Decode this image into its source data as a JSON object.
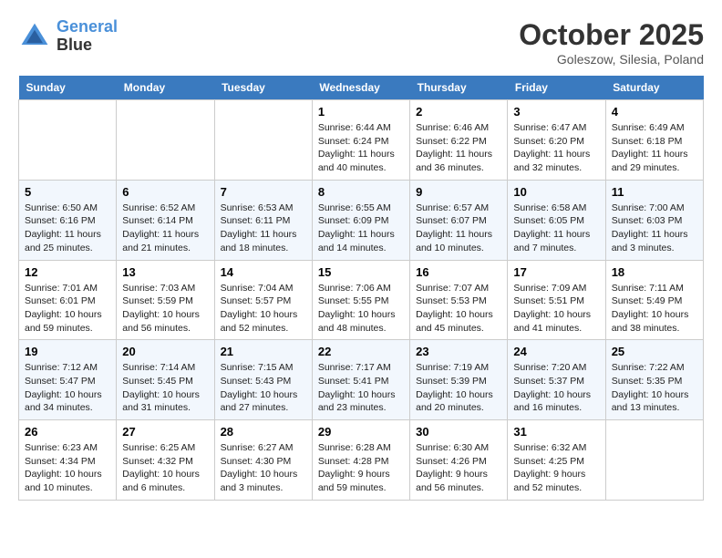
{
  "header": {
    "logo_line1": "General",
    "logo_line2": "Blue",
    "month": "October 2025",
    "location": "Goleszow, Silesia, Poland"
  },
  "weekdays": [
    "Sunday",
    "Monday",
    "Tuesday",
    "Wednesday",
    "Thursday",
    "Friday",
    "Saturday"
  ],
  "weeks": [
    [
      {
        "day": "",
        "info": ""
      },
      {
        "day": "",
        "info": ""
      },
      {
        "day": "",
        "info": ""
      },
      {
        "day": "1",
        "info": "Sunrise: 6:44 AM\nSunset: 6:24 PM\nDaylight: 11 hours\nand 40 minutes."
      },
      {
        "day": "2",
        "info": "Sunrise: 6:46 AM\nSunset: 6:22 PM\nDaylight: 11 hours\nand 36 minutes."
      },
      {
        "day": "3",
        "info": "Sunrise: 6:47 AM\nSunset: 6:20 PM\nDaylight: 11 hours\nand 32 minutes."
      },
      {
        "day": "4",
        "info": "Sunrise: 6:49 AM\nSunset: 6:18 PM\nDaylight: 11 hours\nand 29 minutes."
      }
    ],
    [
      {
        "day": "5",
        "info": "Sunrise: 6:50 AM\nSunset: 6:16 PM\nDaylight: 11 hours\nand 25 minutes."
      },
      {
        "day": "6",
        "info": "Sunrise: 6:52 AM\nSunset: 6:14 PM\nDaylight: 11 hours\nand 21 minutes."
      },
      {
        "day": "7",
        "info": "Sunrise: 6:53 AM\nSunset: 6:11 PM\nDaylight: 11 hours\nand 18 minutes."
      },
      {
        "day": "8",
        "info": "Sunrise: 6:55 AM\nSunset: 6:09 PM\nDaylight: 11 hours\nand 14 minutes."
      },
      {
        "day": "9",
        "info": "Sunrise: 6:57 AM\nSunset: 6:07 PM\nDaylight: 11 hours\nand 10 minutes."
      },
      {
        "day": "10",
        "info": "Sunrise: 6:58 AM\nSunset: 6:05 PM\nDaylight: 11 hours\nand 7 minutes."
      },
      {
        "day": "11",
        "info": "Sunrise: 7:00 AM\nSunset: 6:03 PM\nDaylight: 11 hours\nand 3 minutes."
      }
    ],
    [
      {
        "day": "12",
        "info": "Sunrise: 7:01 AM\nSunset: 6:01 PM\nDaylight: 10 hours\nand 59 minutes."
      },
      {
        "day": "13",
        "info": "Sunrise: 7:03 AM\nSunset: 5:59 PM\nDaylight: 10 hours\nand 56 minutes."
      },
      {
        "day": "14",
        "info": "Sunrise: 7:04 AM\nSunset: 5:57 PM\nDaylight: 10 hours\nand 52 minutes."
      },
      {
        "day": "15",
        "info": "Sunrise: 7:06 AM\nSunset: 5:55 PM\nDaylight: 10 hours\nand 48 minutes."
      },
      {
        "day": "16",
        "info": "Sunrise: 7:07 AM\nSunset: 5:53 PM\nDaylight: 10 hours\nand 45 minutes."
      },
      {
        "day": "17",
        "info": "Sunrise: 7:09 AM\nSunset: 5:51 PM\nDaylight: 10 hours\nand 41 minutes."
      },
      {
        "day": "18",
        "info": "Sunrise: 7:11 AM\nSunset: 5:49 PM\nDaylight: 10 hours\nand 38 minutes."
      }
    ],
    [
      {
        "day": "19",
        "info": "Sunrise: 7:12 AM\nSunset: 5:47 PM\nDaylight: 10 hours\nand 34 minutes."
      },
      {
        "day": "20",
        "info": "Sunrise: 7:14 AM\nSunset: 5:45 PM\nDaylight: 10 hours\nand 31 minutes."
      },
      {
        "day": "21",
        "info": "Sunrise: 7:15 AM\nSunset: 5:43 PM\nDaylight: 10 hours\nand 27 minutes."
      },
      {
        "day": "22",
        "info": "Sunrise: 7:17 AM\nSunset: 5:41 PM\nDaylight: 10 hours\nand 23 minutes."
      },
      {
        "day": "23",
        "info": "Sunrise: 7:19 AM\nSunset: 5:39 PM\nDaylight: 10 hours\nand 20 minutes."
      },
      {
        "day": "24",
        "info": "Sunrise: 7:20 AM\nSunset: 5:37 PM\nDaylight: 10 hours\nand 16 minutes."
      },
      {
        "day": "25",
        "info": "Sunrise: 7:22 AM\nSunset: 5:35 PM\nDaylight: 10 hours\nand 13 minutes."
      }
    ],
    [
      {
        "day": "26",
        "info": "Sunrise: 6:23 AM\nSunset: 4:34 PM\nDaylight: 10 hours\nand 10 minutes."
      },
      {
        "day": "27",
        "info": "Sunrise: 6:25 AM\nSunset: 4:32 PM\nDaylight: 10 hours\nand 6 minutes."
      },
      {
        "day": "28",
        "info": "Sunrise: 6:27 AM\nSunset: 4:30 PM\nDaylight: 10 hours\nand 3 minutes."
      },
      {
        "day": "29",
        "info": "Sunrise: 6:28 AM\nSunset: 4:28 PM\nDaylight: 9 hours\nand 59 minutes."
      },
      {
        "day": "30",
        "info": "Sunrise: 6:30 AM\nSunset: 4:26 PM\nDaylight: 9 hours\nand 56 minutes."
      },
      {
        "day": "31",
        "info": "Sunrise: 6:32 AM\nSunset: 4:25 PM\nDaylight: 9 hours\nand 52 minutes."
      },
      {
        "day": "",
        "info": ""
      }
    ]
  ]
}
